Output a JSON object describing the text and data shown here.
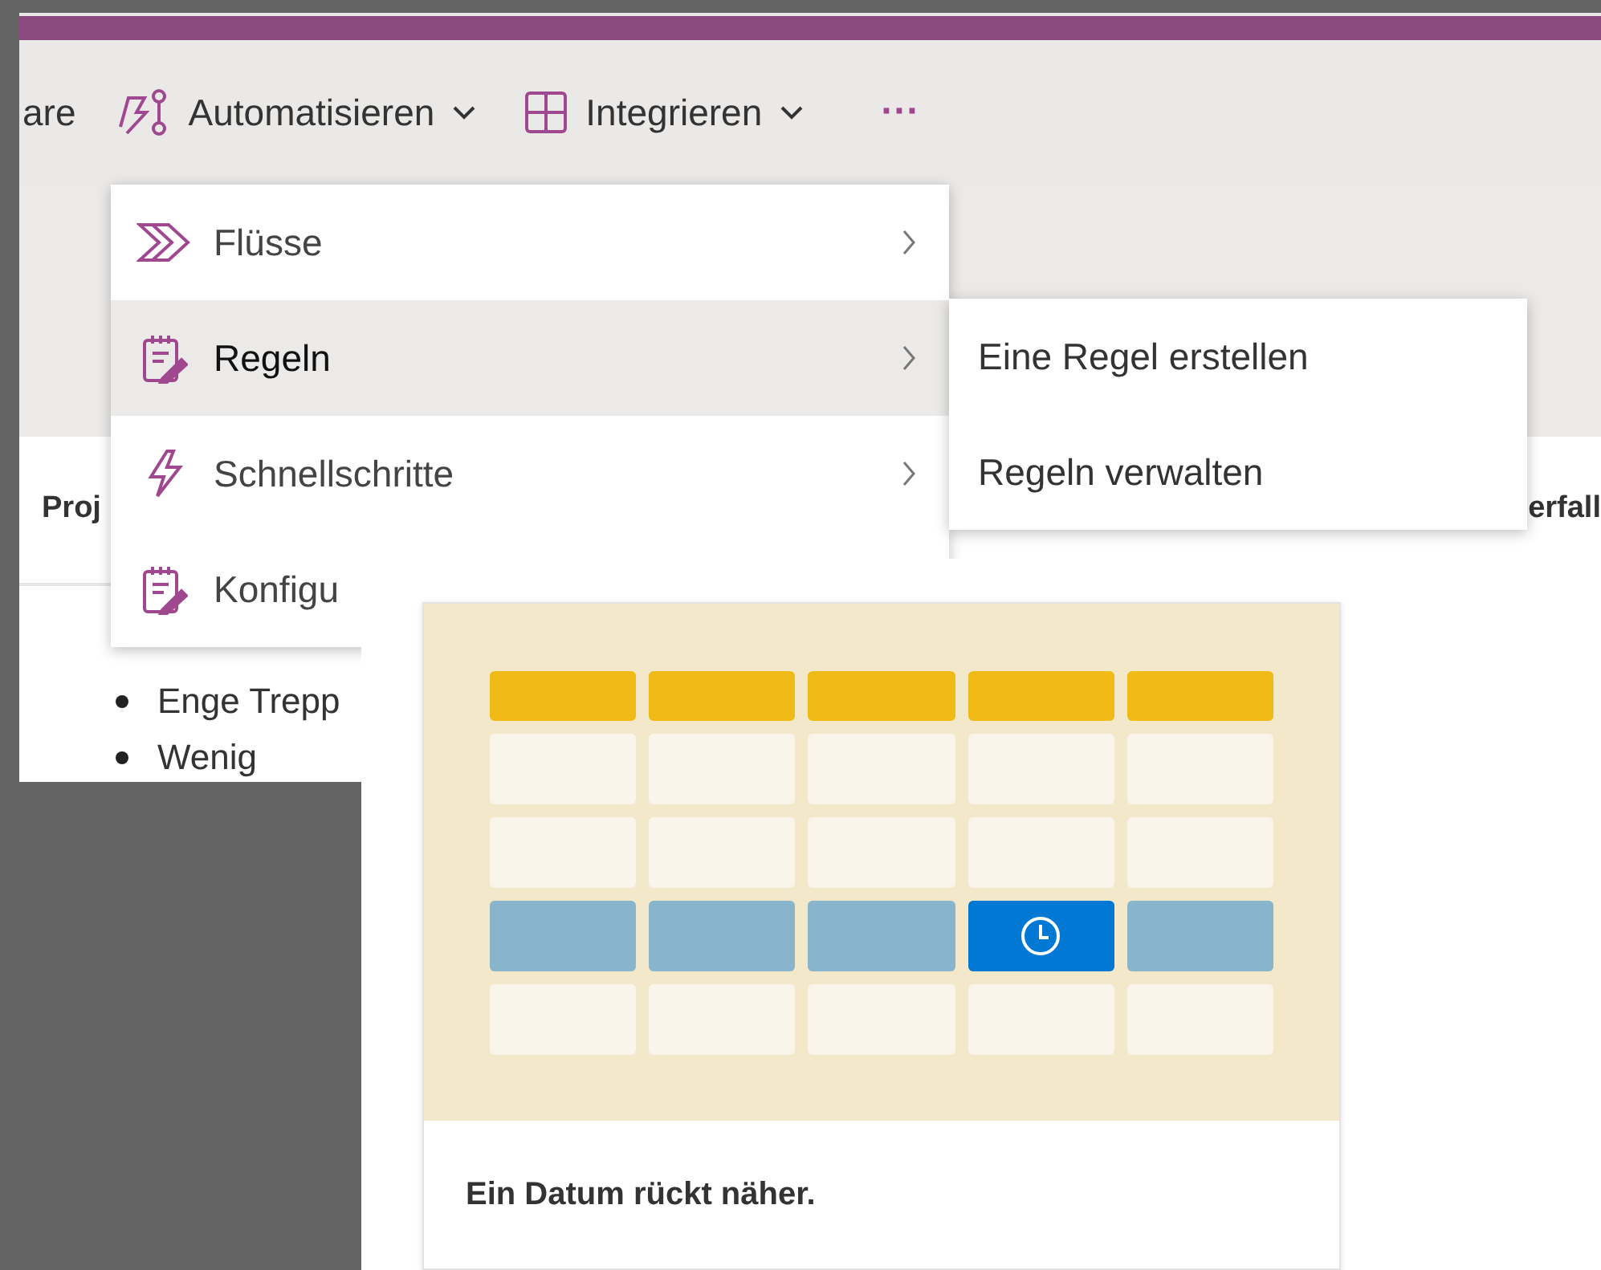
{
  "toolbar": {
    "items": [
      {
        "kind": "text",
        "label": "are"
      },
      {
        "kind": "dropdown",
        "label": "Automatisieren"
      },
      {
        "kind": "dropdown",
        "label": "Integrieren"
      },
      {
        "kind": "more",
        "label": "···"
      }
    ]
  },
  "menu": {
    "items": [
      {
        "label": "Flüsse",
        "selected": false,
        "submenu": true
      },
      {
        "label": "Regeln",
        "selected": true,
        "submenu": true
      },
      {
        "label": "Schnellschritte",
        "selected": false,
        "submenu": true
      },
      {
        "label": "Konfigu",
        "selected": false
      }
    ]
  },
  "submenu": {
    "items": [
      "Eine Regel erstellen",
      "Regeln verwalten"
    ]
  },
  "table": {
    "columns": [
      "Proj",
      "erfall"
    ]
  },
  "list": {
    "items": [
      "Enge Trepp",
      "Wenig"
    ]
  },
  "card": {
    "caption": "Ein Datum rückt näher."
  }
}
